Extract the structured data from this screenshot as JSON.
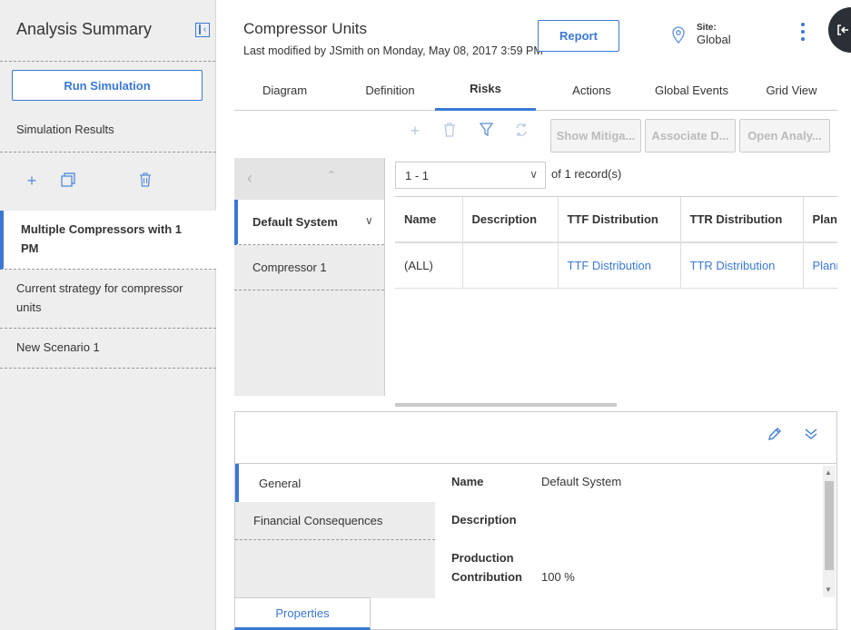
{
  "sidebar": {
    "title": "Analysis Summary",
    "run_button": "Run Simulation",
    "simulation_results": "Simulation Results",
    "items": [
      {
        "label": "Multiple Compressors with 1 PM"
      },
      {
        "label": "Current strategy for compressor units"
      },
      {
        "label": "New Scenario 1"
      }
    ]
  },
  "header": {
    "title": "Compressor Units",
    "subtitle": "Last modified by JSmith on Monday, May 08, 2017 3:59 PM",
    "report_button": "Report",
    "site_label": "Site:",
    "site_value": "Global"
  },
  "tabs": [
    {
      "label": "Diagram"
    },
    {
      "label": "Definition"
    },
    {
      "label": "Risks"
    },
    {
      "label": "Actions"
    },
    {
      "label": "Global Events"
    },
    {
      "label": "Grid View"
    }
  ],
  "toolbar": {
    "show_mitigation": "Show Mitiga...",
    "associate": "Associate D...",
    "open_analysis": "Open Analy..."
  },
  "tree": {
    "items": [
      {
        "label": "Default System"
      },
      {
        "label": "Compressor 1"
      }
    ]
  },
  "pager": {
    "range": "1 - 1",
    "of_text": "of",
    "count": "1",
    "records": "record(s)"
  },
  "grid": {
    "columns": [
      "Name",
      "Description",
      "TTF Distribution",
      "TTR Distribution",
      "Plan"
    ],
    "rows": [
      [
        "(ALL)",
        "",
        "TTF Distribution",
        "TTR Distribution",
        "Planned"
      ]
    ]
  },
  "details": {
    "tabs": [
      {
        "label": "General"
      },
      {
        "label": "Financial Consequences"
      }
    ],
    "fields": {
      "name_label": "Name",
      "name_value": "Default System",
      "description_label": "Description",
      "production_label_1": "Production",
      "production_label_2": "Contribution",
      "production_value": "100 %"
    },
    "properties_tab": "Properties"
  },
  "colors": {
    "accent": "#3a78d4",
    "sidebar_bg": "#eeeeee",
    "round_button_bg": "#2b2f36"
  }
}
